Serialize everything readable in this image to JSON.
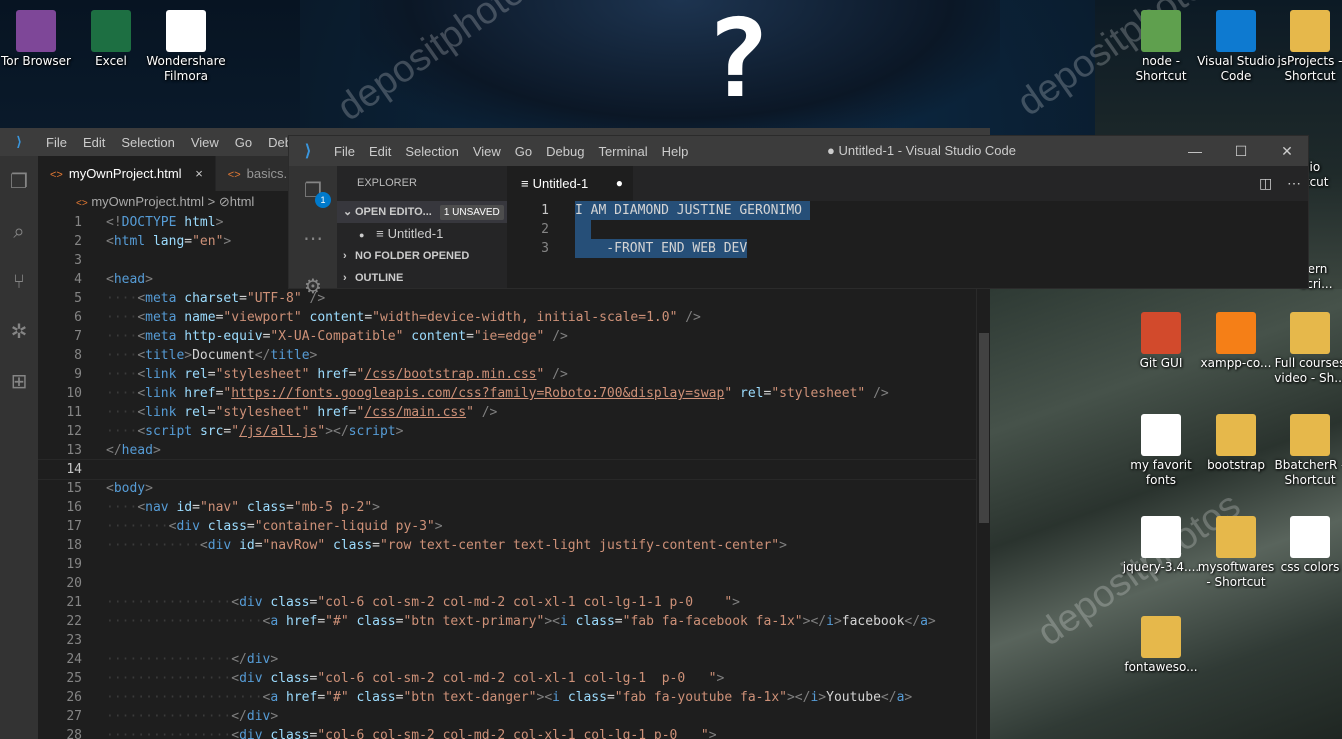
{
  "desktop": {
    "left_icons": [
      {
        "label": "Tor Browser",
        "icon": "tor-icon",
        "color": "#7e4798"
      },
      {
        "label": "Excel",
        "icon": "excel-icon",
        "color": "#1d6f42"
      },
      {
        "label": "Wondershare\nFilmora",
        "icon": "file-icon",
        "color": "#ffffff"
      }
    ],
    "right_icons": [
      {
        "label": "node -\nShortcut",
        "icon": "node-icon",
        "color": "#5fa04e"
      },
      {
        "label": "Visual Studio\nCode",
        "icon": "vscode-icon",
        "color": "#0e7ad0"
      },
      {
        "label": "jsProjects -\nShortcut",
        "icon": "folder-icon",
        "color": "#e6b84b"
      },
      {
        "label": "Git GUI",
        "icon": "git-icon",
        "color": "#d24a2c"
      },
      {
        "label": "xampp-co...",
        "icon": "xampp-icon",
        "color": "#f57f17"
      },
      {
        "label": "Full courses\nvideo - Sh...",
        "icon": "folder-icon",
        "color": "#e6b84b"
      },
      {
        "label": "my favorit\nfonts",
        "icon": "file-icon",
        "color": "#ffffff"
      },
      {
        "label": "bootstrap",
        "icon": "folder-icon",
        "color": "#e6b84b"
      },
      {
        "label": "BbatcherR -\nShortcut",
        "icon": "folder-icon",
        "color": "#e6b84b"
      },
      {
        "label": "jquery-3.4....",
        "icon": "js-file-icon",
        "color": "#ffffff"
      },
      {
        "label": "mysoftwares\n- Shortcut",
        "icon": "folder-icon",
        "color": "#e6b84b"
      },
      {
        "label": "css colors",
        "icon": "file-icon",
        "color": "#ffffff"
      },
      {
        "label": "fontaweso...",
        "icon": "folder-icon",
        "color": "#e6b84b"
      }
    ],
    "partial_labels": [
      "rtfolio\nhortcut",
      "dern\nscri..."
    ],
    "watermark": "depositphotos"
  },
  "main_editor": {
    "menu": [
      "File",
      "Edit",
      "Selection",
      "View",
      "Go",
      "Debug"
    ],
    "tabs": [
      {
        "label": "myOwnProject.html",
        "close": "×",
        "active": true
      },
      {
        "label": "basics.h",
        "active": false
      }
    ],
    "breadcrumb": {
      "file": "myOwnProject.html",
      "sep": ">",
      "node": "html"
    },
    "lines": [
      "1",
      "2",
      "3",
      "4",
      "5",
      "6",
      "7",
      "8",
      "9",
      "10",
      "11",
      "12",
      "13",
      "14",
      "15",
      "16",
      "17",
      "18",
      "19",
      "20",
      "21",
      "22",
      "23",
      "24",
      "25",
      "26",
      "27",
      "28"
    ],
    "current_line": "14"
  },
  "floating_window": {
    "menu": [
      "File",
      "Edit",
      "Selection",
      "View",
      "Go",
      "Debug",
      "Terminal",
      "Help"
    ],
    "title": "● Untitled-1 - Visual Studio Code",
    "explorer_header": "EXPLORER",
    "open_editors": "OPEN EDITO...",
    "unsaved_badge": "1 UNSAVED",
    "open_file": "Untitled-1",
    "no_folder": "NO FOLDER OPENED",
    "outline": "OUTLINE",
    "tab": "Untitled-1",
    "explorer_badge": "1",
    "lines": [
      {
        "n": "1",
        "text": "I AM DIAMOND JUSTINE GERONIMO "
      },
      {
        "n": "2",
        "text": "  "
      },
      {
        "n": "3",
        "text": "    -FRONT END WEB DEV"
      }
    ]
  }
}
